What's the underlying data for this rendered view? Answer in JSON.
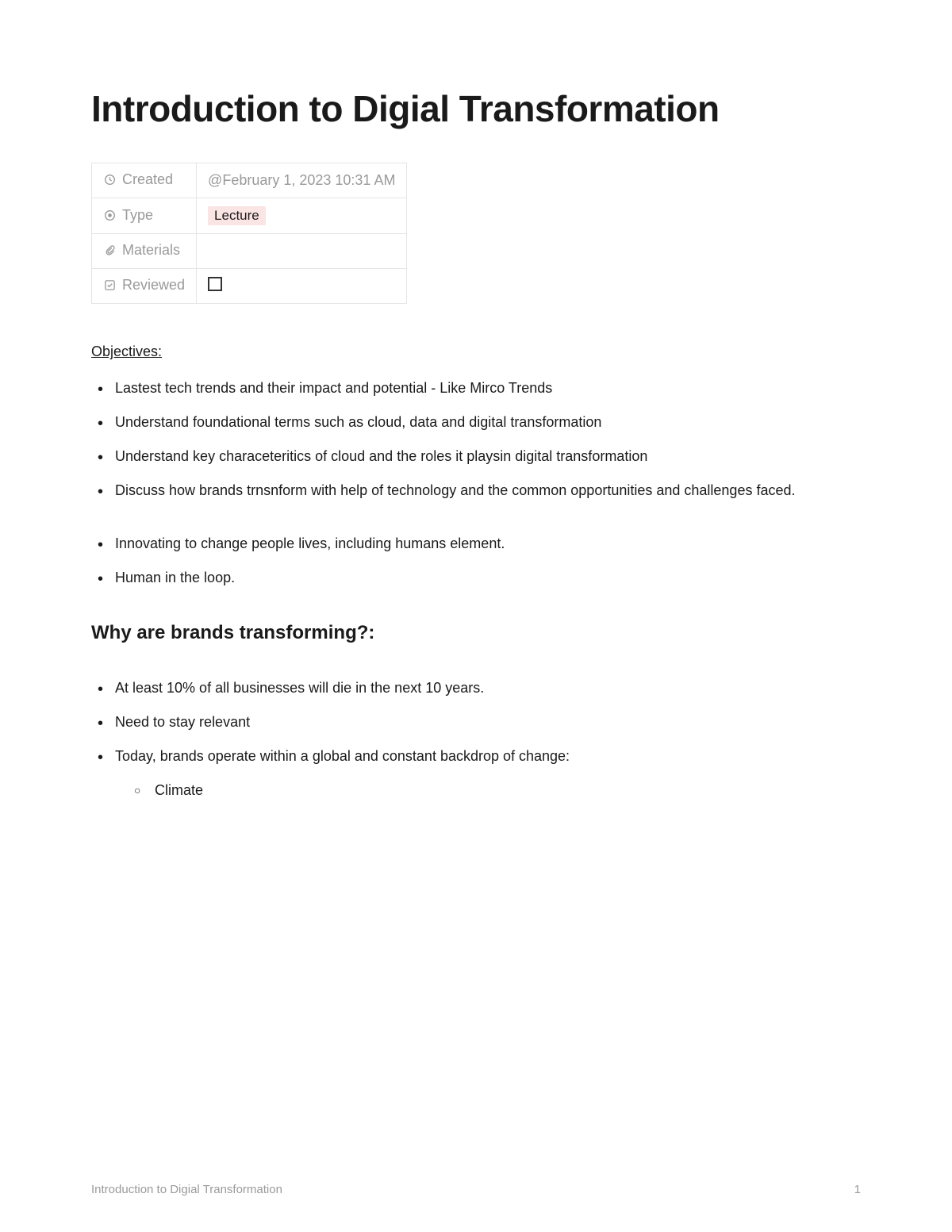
{
  "title": "Introduction to Digial Transformation",
  "properties": {
    "created": {
      "label": "Created",
      "value": "@February 1, 2023 10:31 AM"
    },
    "type": {
      "label": "Type",
      "value": "Lecture"
    },
    "materials": {
      "label": "Materials",
      "value": ""
    },
    "reviewed": {
      "label": "Reviewed",
      "checked": false
    }
  },
  "objectives": {
    "heading": "Objectives:",
    "items": [
      "Lastest tech trends and their impact and potential - Like Mirco Trends",
      "Understand foundational terms such as cloud, data and digital transformation",
      "Understand key characeteritics of cloud and the roles it playsin digital transformation",
      "Discuss how brands trnsnform with help of technology and the common opportunities and challenges faced."
    ],
    "items2": [
      "Innovating to change people lives, including humans element.",
      "Human in the loop."
    ]
  },
  "section1": {
    "heading": "Why are brands transforming?:",
    "items": [
      "At least 10% of all businesses will die in the next 10 years.",
      "Need to stay relevant",
      "Today, brands operate within a global and constant backdrop of change:"
    ],
    "subitems": [
      "Climate"
    ]
  },
  "footer": {
    "title": "Introduction to Digial Transformation",
    "page": "1"
  }
}
